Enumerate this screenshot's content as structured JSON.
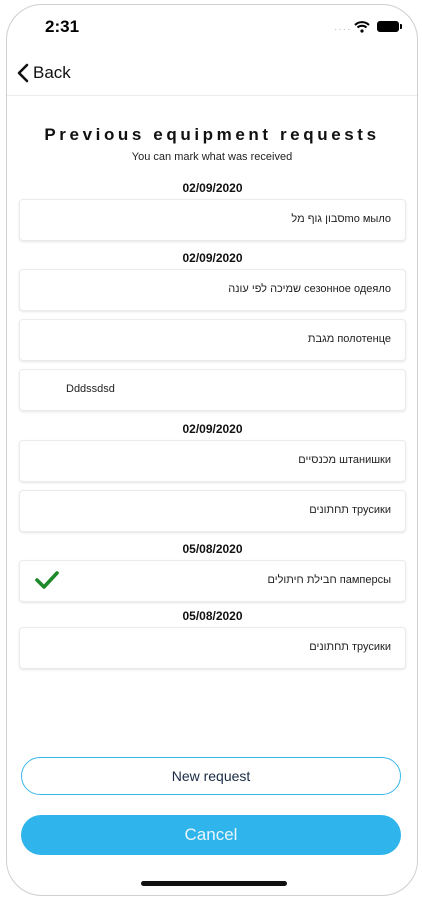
{
  "status_bar": {
    "time": "2:31",
    "signal": "····"
  },
  "nav": {
    "back_label": "Back"
  },
  "page": {
    "title": "Previous equipment requests",
    "subtitle": "You can mark what was received"
  },
  "groups": [
    {
      "date": "02/09/2020",
      "items": [
        {
          "label": "סבון גוף מלmo мыло",
          "received": false
        }
      ]
    },
    {
      "date": "02/09/2020",
      "items": [
        {
          "label": "שמיכה לפי עונה сезонное одеяло",
          "received": false
        },
        {
          "label": "מגבת полотенце",
          "received": false
        },
        {
          "label": "Dddssdsd",
          "received": false
        }
      ]
    },
    {
      "date": "02/09/2020",
      "items": [
        {
          "label": "מכנסיים штанишки",
          "received": false
        },
        {
          "label": "תחתונים трусики",
          "received": false
        }
      ]
    },
    {
      "date": "05/08/2020",
      "items": [
        {
          "label": "חבילת חיתולים памперсы",
          "received": true
        }
      ]
    },
    {
      "date": "05/08/2020",
      "items": [
        {
          "label": "תחתונים трусики",
          "received": false
        }
      ]
    }
  ],
  "buttons": {
    "new_request": "New request",
    "cancel": "Cancel"
  },
  "colors": {
    "accent": "#2fb4ec",
    "check": "#1f8a2a"
  }
}
